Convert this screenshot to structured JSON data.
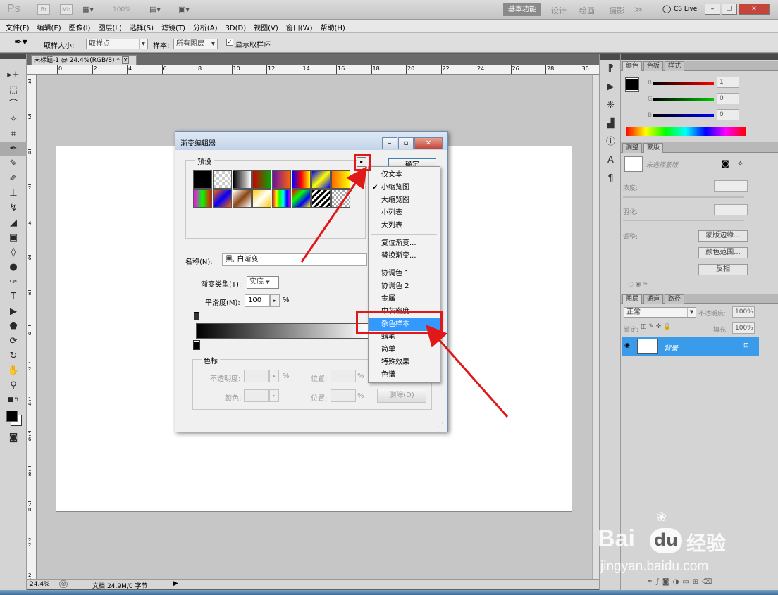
{
  "app": {
    "logo": "Ps",
    "bridge": "Br",
    "minibridge": "Mb",
    "zoom": "100%",
    "workspaces": [
      "基本功能",
      "设计",
      "绘画",
      "摄影"
    ],
    "more": "≫",
    "cslive": "CS Live"
  },
  "menu": [
    "文件(F)",
    "编辑(E)",
    "图像(I)",
    "图层(L)",
    "选择(S)",
    "滤镜(T)",
    "分析(A)",
    "3D(D)",
    "视图(V)",
    "窗口(W)",
    "帮助(H)"
  ],
  "options": {
    "sample_size_label": "取样大小:",
    "sample_size_value": "取样点",
    "sample_label": "样本:",
    "sample_value": "所有图层",
    "show_ring_label": "显示取样环"
  },
  "document": {
    "tab_title": "未标题-1 @ 24.4%(RGB/8) *",
    "ruler_h": [
      "0",
      "2",
      "4",
      "6",
      "8",
      "10",
      "12",
      "14",
      "16",
      "18",
      "20",
      "22",
      "24",
      "26",
      "28",
      "30"
    ],
    "ruler_v": [
      "4",
      "2",
      "0",
      "2",
      "4",
      "6",
      "8",
      "1\n0",
      "1\n2",
      "1\n4",
      "1\n6",
      "1\n8",
      "2\n0",
      "2\n2",
      "2\n4"
    ],
    "zoom_status": "24.4%",
    "doc_status": "文档:24.9M/0 字节"
  },
  "color_panel": {
    "tabs": [
      "颜色",
      "色板",
      "样式"
    ],
    "r_label": "R",
    "g_label": "G",
    "b_label": "B",
    "r_value": "1",
    "g_value": "0",
    "b_value": "0"
  },
  "mask_panel": {
    "tabs": [
      "调整",
      "蒙版"
    ],
    "no_mask": "未选择蒙版",
    "density": "浓度:",
    "feather": "羽化:",
    "refine": "调整:",
    "btn_edge": "蒙版边缘...",
    "btn_range": "颜色范围...",
    "btn_invert": "反相"
  },
  "layers_panel": {
    "tabs": [
      "图层",
      "通道",
      "路径"
    ],
    "blend": "正常",
    "opacity_label": "不透明度:",
    "opacity_value": "100%",
    "lock_label": "锁定:",
    "fill_label": "填充:",
    "fill_value": "100%",
    "layer_name": "背景"
  },
  "dialog": {
    "title": "渐变编辑器",
    "presets_label": "预设",
    "ok": "确定",
    "name_label": "名称(N):",
    "name_value": "黑, 白渐变",
    "type_label": "渐变类型(T):",
    "type_value": "实底",
    "smooth_label": "平滑度(M):",
    "smooth_value": "100",
    "percent": "%",
    "stops_label": "色标",
    "opacity_label": "不透明度:",
    "position_label": "位置:",
    "color_label": "颜色:",
    "delete_btn": "删除(D)"
  },
  "context_menu": {
    "items_a": [
      "仅文本",
      "小缩览图",
      "大缩览图",
      "小列表",
      "大列表"
    ],
    "checked": "✔",
    "items_b": [
      "复位渐变...",
      "替换渐变..."
    ],
    "items_c": [
      "协调色 1",
      "协调色 2",
      "金属",
      "中灰密度",
      "杂色样本",
      "蜡笔",
      "简单",
      "特殊效果",
      "色谱"
    ]
  },
  "watermark": {
    "brand_a": "Bai",
    "brand_b": "du",
    "brand_c": "经验",
    "url": "jingyan.baidu.com"
  },
  "colors": {
    "highlight": "#3399ff",
    "annotation_red": "#e01818",
    "layer_selected": "#3a9bea"
  }
}
